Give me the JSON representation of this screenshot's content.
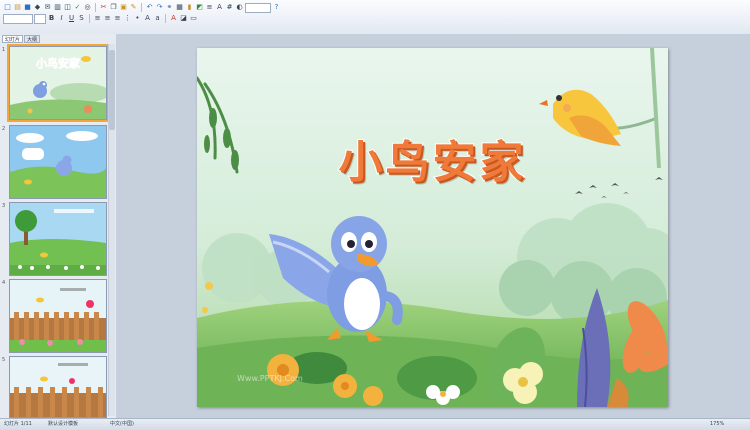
{
  "tabs": [
    {
      "label": "幻灯片"
    },
    {
      "label": "大纲"
    }
  ],
  "slides": [
    {
      "number": "1",
      "title": "小鸟安家"
    },
    {
      "number": "2"
    },
    {
      "number": "3"
    },
    {
      "number": "4"
    },
    {
      "number": "5"
    }
  ],
  "main_slide": {
    "title": "小鸟安家",
    "watermark": "Www.PPTKJ.Com"
  },
  "status": {
    "slide_info": "幻灯片 1/11",
    "theme": "默认设计模板",
    "language": "中文(中国)",
    "zoom": "175%"
  },
  "colors": {
    "title": "#f07a3a",
    "accent": "#f4a63a",
    "sky": "#dff1e6",
    "grass": "#7fc16a"
  },
  "icons": [
    "new-icon",
    "open-icon",
    "save-icon",
    "print-icon",
    "preview-icon",
    "spell-icon",
    "cut-icon",
    "copy-icon",
    "paste-icon",
    "format-painter-icon",
    "undo-icon",
    "redo-icon",
    "hyperlink-icon",
    "table-icon",
    "chart-icon",
    "zoom-icon",
    "help-icon"
  ]
}
